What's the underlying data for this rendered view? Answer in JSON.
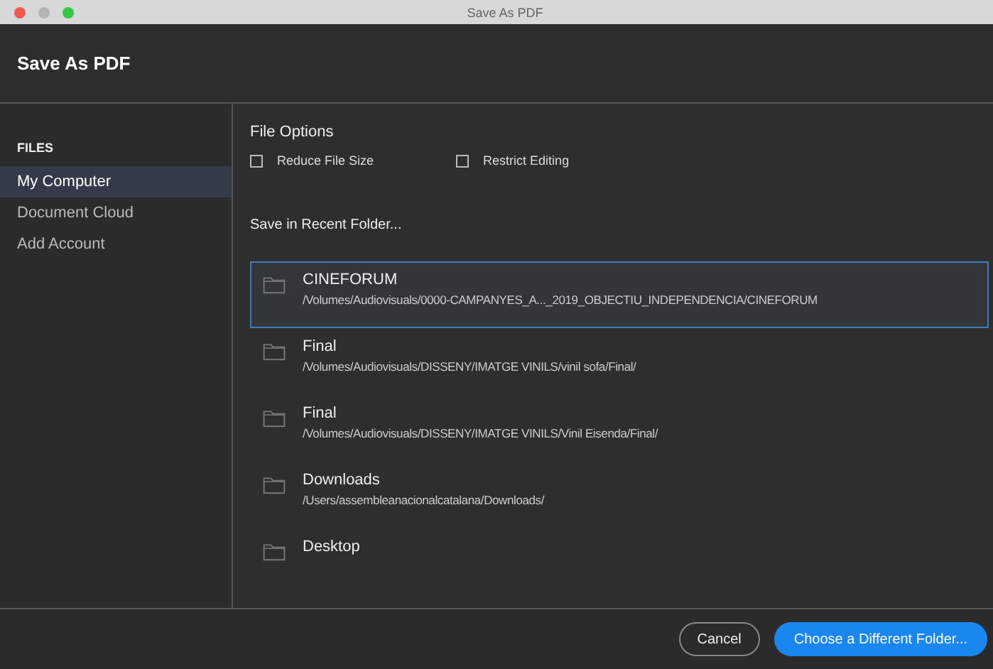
{
  "window": {
    "title": "Save As PDF"
  },
  "header": {
    "title": "Save As PDF"
  },
  "sidebar": {
    "heading": "FILES",
    "items": [
      {
        "label": "My Computer",
        "selected": true
      },
      {
        "label": "Document Cloud",
        "selected": false
      },
      {
        "label": "Add Account",
        "selected": false
      }
    ]
  },
  "file_options": {
    "heading": "File Options",
    "checkboxes": [
      {
        "label": "Reduce File Size",
        "checked": false
      },
      {
        "label": "Restrict Editing",
        "checked": false
      }
    ]
  },
  "recent": {
    "heading": "Save in Recent Folder...",
    "folders": [
      {
        "name": "CINEFORUM",
        "path": "/Volumes/Audiovisuals/0000-CAMPANYES_A..._2019_OBJECTIU_INDEPENDENCIA/CINEFORUM",
        "selected": true
      },
      {
        "name": "Final",
        "path": "/Volumes/Audiovisuals/DISSENY/IMATGE VINILS/vinil sofa/Final/",
        "selected": false
      },
      {
        "name": "Final",
        "path": "/Volumes/Audiovisuals/DISSENY/IMATGE VINILS/Vinil Eisenda/Final/",
        "selected": false
      },
      {
        "name": "Downloads",
        "path": "/Users/assembleanacionalcatalana/Downloads/",
        "selected": false
      },
      {
        "name": "Desktop",
        "selected": false
      }
    ]
  },
  "buttons": [
    {
      "label": "Cancel",
      "kind": "secondary"
    },
    {
      "label": "Choose a Different Folder...",
      "kind": "primary"
    }
  ]
}
